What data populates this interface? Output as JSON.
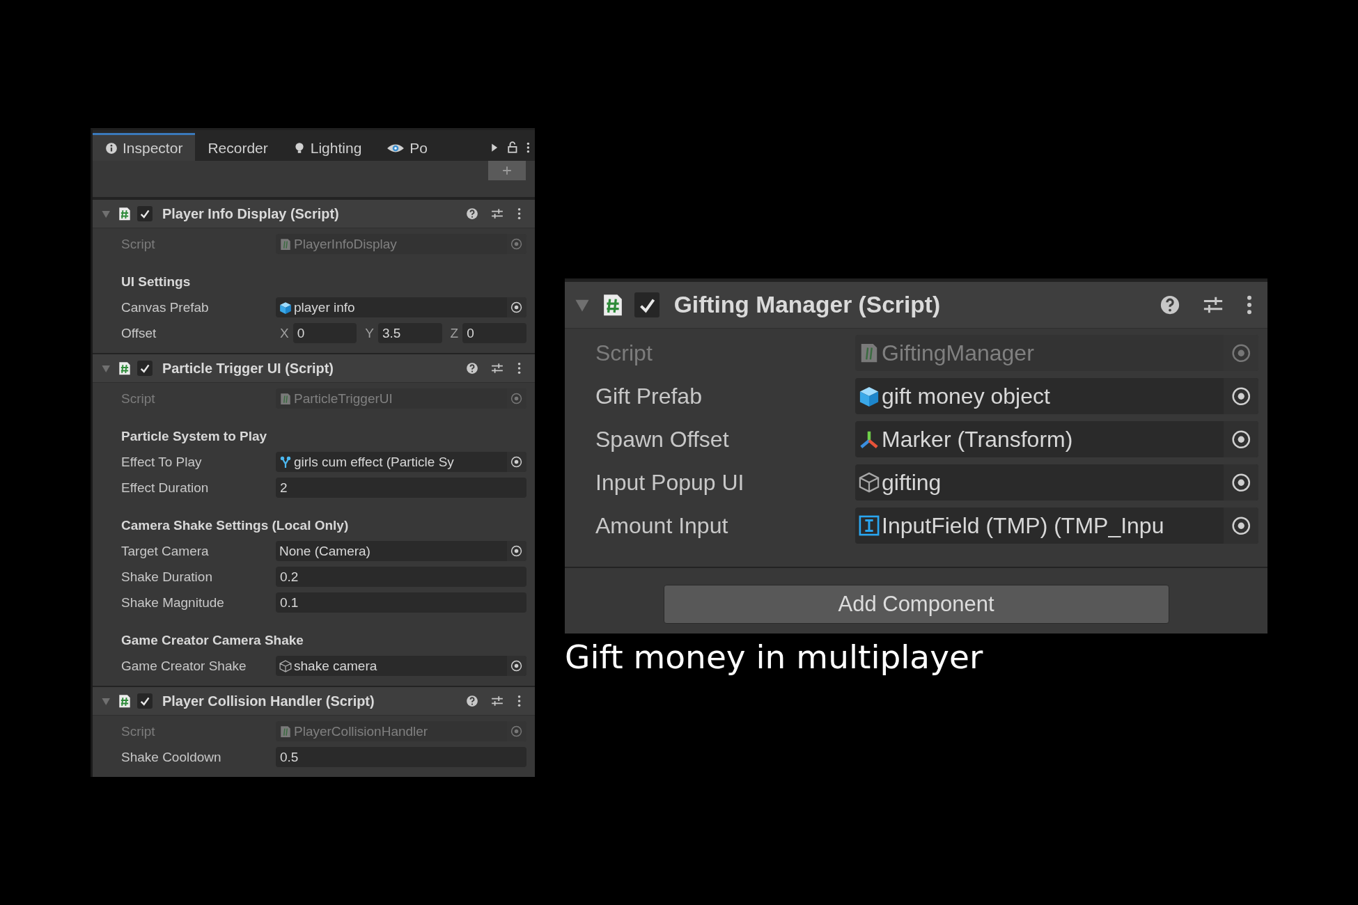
{
  "inspector_window": {
    "tabs": [
      {
        "label": "Inspector",
        "kind": "info",
        "selected": true
      },
      {
        "label": "Recorder",
        "kind": "plain",
        "selected": false
      },
      {
        "label": "Lighting",
        "kind": "light",
        "selected": false
      },
      {
        "label": "Po",
        "kind": "eye",
        "selected": false
      }
    ],
    "components": [
      {
        "title": "Player Info Display (Script)",
        "expanded": true,
        "enabled": true,
        "properties": [
          {
            "kind": "script",
            "label": "Script",
            "value": "PlayerInfoDisplay"
          },
          {
            "kind": "header",
            "label": "UI Settings"
          },
          {
            "kind": "prefab",
            "label": "Canvas Prefab",
            "value": "player info"
          },
          {
            "kind": "vector3",
            "label": "Offset",
            "axes": [
              {
                "axis": "X",
                "value": "0"
              },
              {
                "axis": "Y",
                "value": "3.5"
              },
              {
                "axis": "Z",
                "value": "0"
              }
            ]
          }
        ]
      },
      {
        "title": "Particle Trigger UI (Script)",
        "expanded": true,
        "enabled": true,
        "properties": [
          {
            "kind": "script",
            "label": "Script",
            "value": "ParticleTriggerUI"
          },
          {
            "kind": "header",
            "label": "Particle System to Play"
          },
          {
            "kind": "particle",
            "label": "Effect To Play",
            "value": "girls cum effect (Particle Sy"
          },
          {
            "kind": "number",
            "label": "Effect Duration",
            "value": "2"
          },
          {
            "kind": "header",
            "label": "Camera Shake Settings (Local Only)"
          },
          {
            "kind": "none",
            "label": "Target Camera",
            "value": "None (Camera)"
          },
          {
            "kind": "number",
            "label": "Shake Duration",
            "value": "0.2"
          },
          {
            "kind": "number",
            "label": "Shake Magnitude",
            "value": "0.1"
          },
          {
            "kind": "header",
            "label": "Game Creator Camera Shake"
          },
          {
            "kind": "gameobject",
            "label": "Game Creator Shake",
            "value": "shake camera"
          }
        ]
      },
      {
        "title": "Player Collision Handler (Script)",
        "expanded": true,
        "enabled": true,
        "properties": [
          {
            "kind": "script",
            "label": "Script",
            "value": "PlayerCollisionHandler"
          },
          {
            "kind": "number",
            "label": "Shake Cooldown",
            "value": "0.5"
          }
        ]
      }
    ]
  },
  "gifting_panel": {
    "components": [
      {
        "title": "Gifting Manager (Script)",
        "expanded": true,
        "enabled": true,
        "properties": [
          {
            "kind": "script",
            "label": "Script",
            "value": "GiftingManager"
          },
          {
            "kind": "prefab",
            "label": "Gift Prefab",
            "value": "gift money object"
          },
          {
            "kind": "transform",
            "label": "Spawn Offset",
            "value": "Marker (Transform)"
          },
          {
            "kind": "gameobject",
            "label": "Input Popup UI",
            "value": "gifting"
          },
          {
            "kind": "inputfield",
            "label": "Amount Input",
            "value": "InputField (TMP) (TMP_Inpu"
          }
        ]
      }
    ],
    "add_component_button": "Add Component"
  },
  "caption": "Gift money in multiplayer"
}
